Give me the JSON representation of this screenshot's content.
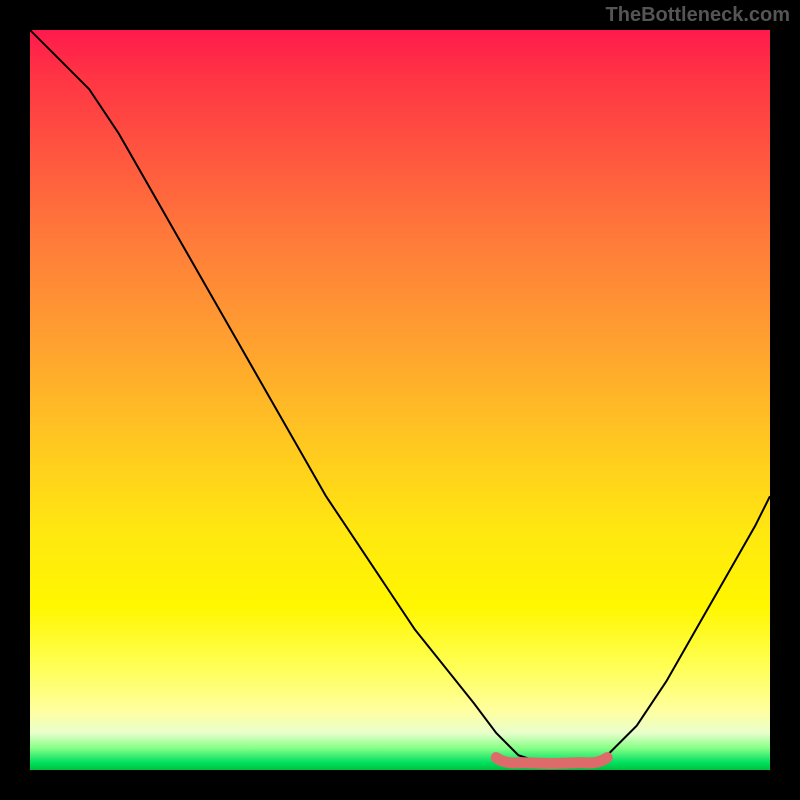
{
  "watermark": "TheBottleneck.com",
  "chart_data": {
    "type": "line",
    "title": "",
    "xlabel": "",
    "ylabel": "",
    "xlim": [
      0,
      100
    ],
    "ylim": [
      0,
      100
    ],
    "grid": false,
    "legend": false,
    "background": "rainbow-gradient-vertical",
    "series": [
      {
        "name": "bottleneck-curve",
        "x": [
          0,
          4,
          8,
          12,
          16,
          20,
          24,
          28,
          32,
          36,
          40,
          44,
          48,
          52,
          56,
          60,
          63,
          66,
          69,
          72,
          75,
          78,
          82,
          86,
          90,
          94,
          98,
          100
        ],
        "y": [
          100,
          96,
          92,
          86,
          79,
          72,
          65,
          58,
          51,
          44,
          37,
          31,
          25,
          19,
          14,
          9,
          5,
          2,
          1,
          1,
          1,
          2,
          6,
          12,
          19,
          26,
          33,
          37
        ]
      }
    ],
    "optimal_region": {
      "x_start": 63,
      "x_end": 78,
      "y": 1
    },
    "colors": {
      "top": "#ff1a4d",
      "mid": "#ffe810",
      "bottom": "#00c040",
      "curve": "#000000",
      "marker": "#dd6b69",
      "frame": "#000000"
    }
  }
}
